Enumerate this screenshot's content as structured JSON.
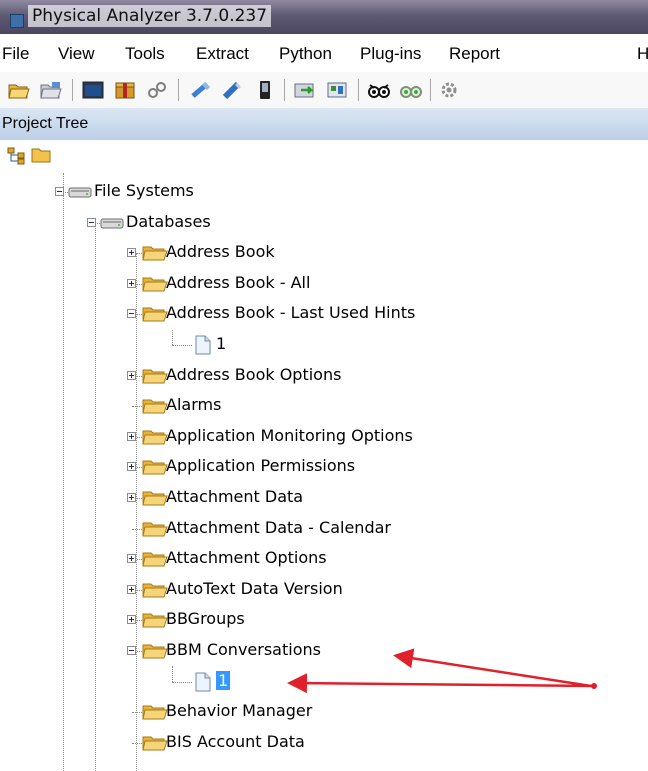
{
  "window": {
    "title": "Physical Analyzer 3.7.0.237"
  },
  "menu": [
    "File",
    "View",
    "Tools",
    "Extract",
    "Python",
    "Plug-ins",
    "Report",
    "H"
  ],
  "panel": {
    "title": "Project Tree"
  },
  "tree": [
    {
      "label": "File Systems",
      "icon": "drive-icon",
      "expander": "minus",
      "selected": false
    },
    {
      "label": "Databases",
      "icon": "drive-icon",
      "expander": "minus",
      "selected": false
    },
    {
      "label": "Address Book",
      "icon": "folder-icon",
      "expander": "plus",
      "selected": false
    },
    {
      "label": "Address Book - All",
      "icon": "folder-icon",
      "expander": "plus",
      "selected": false
    },
    {
      "label": "Address Book - Last Used Hints",
      "icon": "folder-icon",
      "expander": "minus",
      "selected": false
    },
    {
      "label": "1",
      "icon": "file-icon",
      "expander": "none",
      "selected": false
    },
    {
      "label": "Address Book Options",
      "icon": "folder-icon",
      "expander": "plus",
      "selected": false
    },
    {
      "label": "Alarms",
      "icon": "folder-icon",
      "expander": "none",
      "selected": false
    },
    {
      "label": "Application Monitoring Options",
      "icon": "folder-icon",
      "expander": "plus",
      "selected": false
    },
    {
      "label": "Application Permissions",
      "icon": "folder-icon",
      "expander": "plus",
      "selected": false
    },
    {
      "label": "Attachment Data",
      "icon": "folder-icon",
      "expander": "plus",
      "selected": false
    },
    {
      "label": "Attachment Data - Calendar",
      "icon": "folder-icon",
      "expander": "none",
      "selected": false
    },
    {
      "label": "Attachment Options",
      "icon": "folder-icon",
      "expander": "plus",
      "selected": false
    },
    {
      "label": "AutoText Data Version",
      "icon": "folder-icon",
      "expander": "plus",
      "selected": false
    },
    {
      "label": "BBGroups",
      "icon": "folder-icon",
      "expander": "plus",
      "selected": false
    },
    {
      "label": "BBM Conversations",
      "icon": "folder-icon",
      "expander": "minus",
      "selected": false
    },
    {
      "label": "1",
      "icon": "file-icon",
      "expander": "none",
      "selected": true
    },
    {
      "label": "Behavior Manager",
      "icon": "folder-icon",
      "expander": "none",
      "selected": false
    },
    {
      "label": "BIS Account Data",
      "icon": "folder-icon",
      "expander": "none",
      "selected": false
    }
  ],
  "colors": {
    "selection": "#3399ff",
    "annotation_arrow": "#e0202a",
    "folder": "#f2c75a"
  }
}
